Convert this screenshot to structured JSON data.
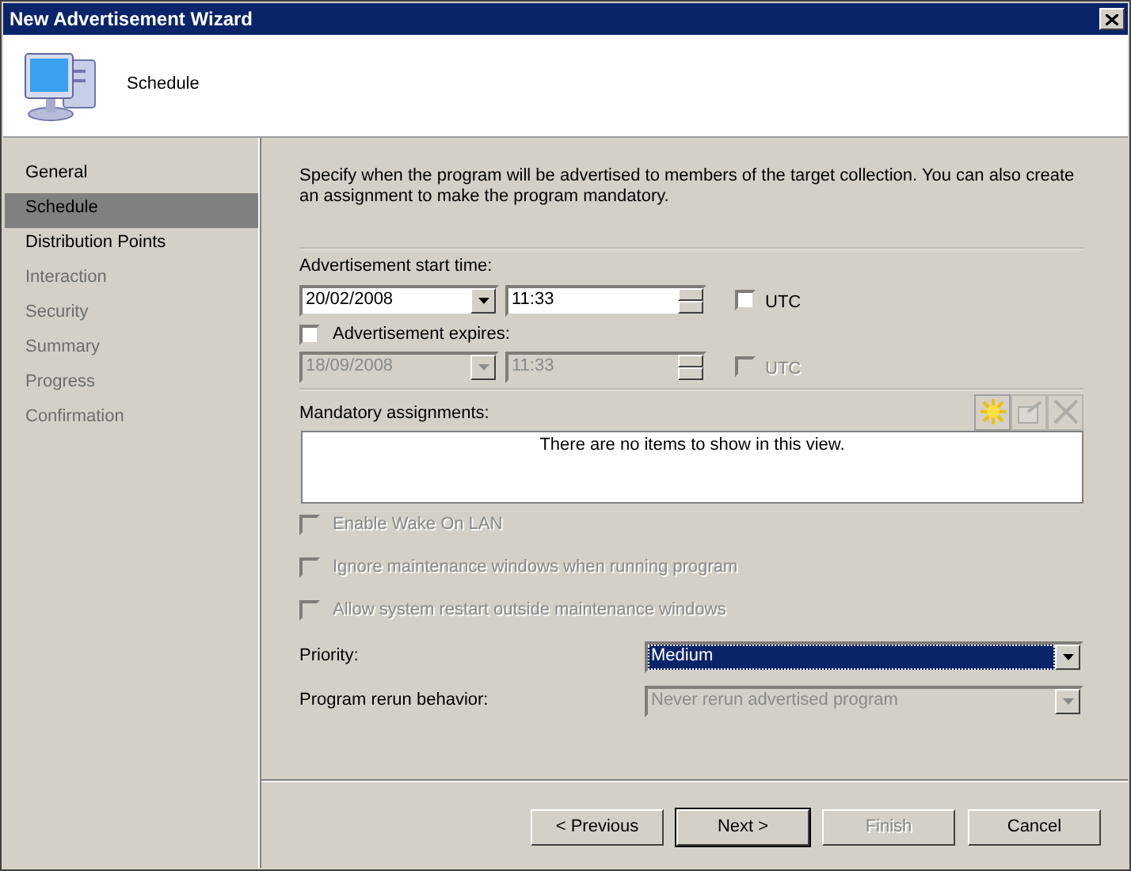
{
  "window": {
    "title": "New Advertisement Wizard"
  },
  "header": {
    "title": "Schedule"
  },
  "steps": [
    {
      "label": "General",
      "selected": false,
      "disabled": false
    },
    {
      "label": "Schedule",
      "selected": true,
      "disabled": false
    },
    {
      "label": "Distribution Points",
      "selected": false,
      "disabled": false
    },
    {
      "label": "Interaction",
      "selected": false,
      "disabled": true
    },
    {
      "label": "Security",
      "selected": false,
      "disabled": true
    },
    {
      "label": "Summary",
      "selected": false,
      "disabled": true
    },
    {
      "label": "Progress",
      "selected": false,
      "disabled": true
    },
    {
      "label": "Confirmation",
      "selected": false,
      "disabled": true
    }
  ],
  "description": "Specify when the program will be advertised to members of the target collection. You can also create an assignment to make the program mandatory.",
  "start": {
    "label": "Advertisement start time:",
    "date": "20/02/2008",
    "time": "11:33",
    "disabled": false,
    "utc": {
      "label": "UTC",
      "checked": false
    }
  },
  "expires": {
    "label": "Advertisement expires:",
    "checked": false,
    "date": "18/09/2008",
    "time": "11:33",
    "disabled": true,
    "utc": {
      "label": "UTC",
      "checked": false
    }
  },
  "mandatory": {
    "label": "Mandatory assignments:",
    "empty_text": "There are no items to show in this view.",
    "tools": [
      {
        "kind": "new",
        "disabled": false
      },
      {
        "kind": "properties",
        "disabled": true
      },
      {
        "kind": "delete",
        "disabled": true
      }
    ]
  },
  "options": [
    {
      "label": "Enable Wake On LAN",
      "checked": false,
      "disabled": true
    },
    {
      "label": "Ignore maintenance windows when running program",
      "checked": false,
      "disabled": true
    },
    {
      "label": "Allow system restart outside maintenance windows",
      "checked": false,
      "disabled": true
    }
  ],
  "fields": [
    {
      "label": "Priority:",
      "value": "Medium",
      "selected": true,
      "disabled": false
    },
    {
      "label": "Program rerun behavior:",
      "value": "Never rerun advertised program",
      "selected": false,
      "disabled": true
    }
  ],
  "buttons": [
    {
      "label": "< Previous",
      "default": false,
      "disabled": false
    },
    {
      "label": "Next >",
      "default": true,
      "disabled": false
    },
    {
      "label": "Finish",
      "default": false,
      "disabled": true
    },
    {
      "label": "Cancel",
      "default": false,
      "disabled": false
    }
  ]
}
